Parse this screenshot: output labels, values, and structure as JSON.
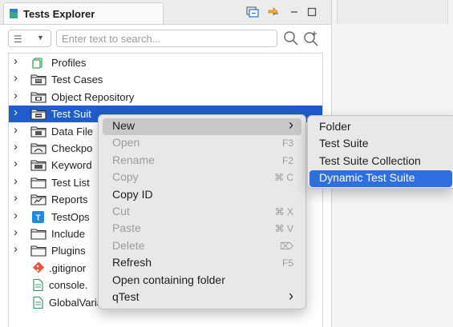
{
  "explorer": {
    "tab_title": "Tests Explorer",
    "search_placeholder": "Enter text to search...",
    "tree": [
      {
        "label": "Profiles",
        "icon": "profile-icon"
      },
      {
        "label": "Test Cases",
        "icon": "folder-testcase-icon"
      },
      {
        "label": "Object Repository",
        "icon": "folder-object-icon"
      },
      {
        "label": "Test Suit",
        "icon": "folder-suite-icon",
        "selected": true
      },
      {
        "label": "Data File",
        "icon": "folder-data-icon"
      },
      {
        "label": "Checkpo",
        "icon": "folder-checkpoint-icon"
      },
      {
        "label": "Keyword",
        "icon": "folder-keyword-icon"
      },
      {
        "label": "Test List",
        "icon": "folder-icon"
      },
      {
        "label": "Reports",
        "icon": "folder-reports-icon"
      },
      {
        "label": "TestOps",
        "icon": "testops-icon"
      },
      {
        "label": "Include",
        "icon": "folder-icon"
      },
      {
        "label": "Plugins",
        "icon": "folder-icon"
      },
      {
        "label": ".gitignor",
        "icon": "git-icon"
      },
      {
        "label": "console.",
        "icon": "file-icon"
      },
      {
        "label": "GlobalVariables.glbl",
        "icon": "file-icon"
      }
    ]
  },
  "context_menu": {
    "items": [
      {
        "label": "New",
        "shortcut": "",
        "submenu": true,
        "disabled": false,
        "hover": true
      },
      {
        "label": "Open",
        "shortcut": "F3",
        "disabled": true
      },
      {
        "label": "Rename",
        "shortcut": "F2",
        "disabled": true
      },
      {
        "label": "Copy",
        "shortcut": "⌘ C",
        "disabled": true
      },
      {
        "label": "Copy ID",
        "shortcut": "",
        "disabled": false
      },
      {
        "label": "Cut",
        "shortcut": "⌘ X",
        "disabled": true
      },
      {
        "label": "Paste",
        "shortcut": "⌘ V",
        "disabled": true
      },
      {
        "label": "Delete",
        "shortcut": "⌦",
        "disabled": true
      },
      {
        "label": "Refresh",
        "shortcut": "F5",
        "disabled": false
      },
      {
        "label": "Open containing folder",
        "shortcut": "",
        "disabled": false
      },
      {
        "label": "qTest",
        "shortcut": "",
        "submenu": true,
        "disabled": false
      }
    ]
  },
  "submenu": {
    "items": [
      {
        "label": "Folder"
      },
      {
        "label": "Test Suite"
      },
      {
        "label": "Test Suite Collection"
      },
      {
        "label": "Dynamic Test Suite",
        "highlight": true
      }
    ]
  },
  "colors": {
    "selection": "#1f5dcc",
    "submenu_highlight": "#2e6fe0",
    "menu_bg": "#e9e8e8"
  }
}
